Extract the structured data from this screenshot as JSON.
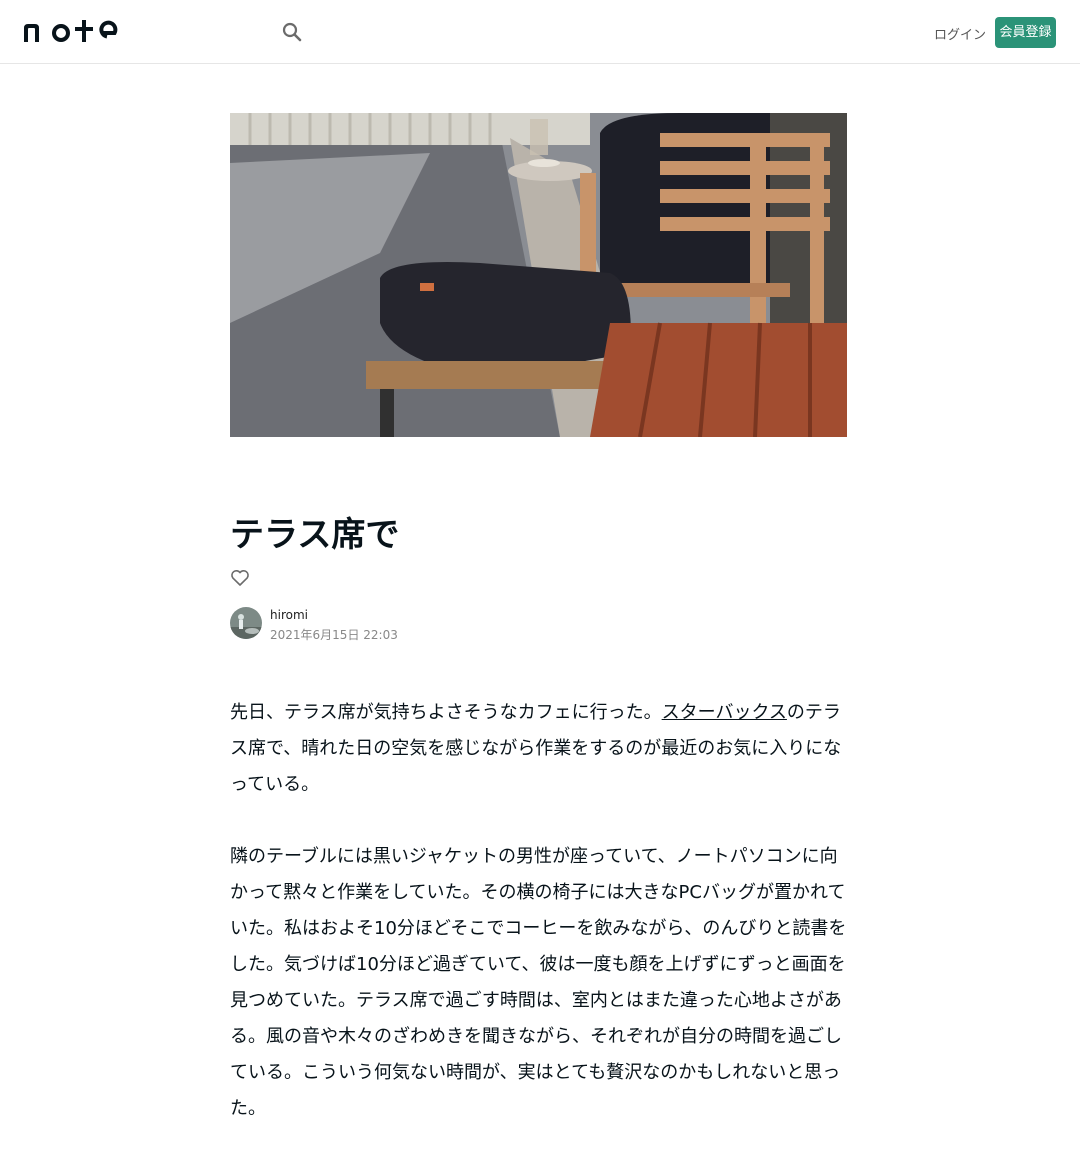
{
  "header": {
    "logo_text": "note",
    "login_label": "ログイン",
    "signup_label": "会員登録",
    "accent_color": "#2b9378"
  },
  "article": {
    "title": "テラス席で",
    "author": "hiromi",
    "date": "2021年6月15日 22:03",
    "paragraph1_before": "先日、テラス席が気持ちよさそうなカフェに行った。",
    "paragraph1_link": "スターバックス",
    "paragraph1_after": "のテラス席で、晴れた日の空気を感じながら作業をするのが最近のお気に入りになっている。",
    "paragraph2": "隣のテーブルには黒いジャケットの男性が座っていて、ノートパソコンに向かって黙々と作業をしていた。その横の椅子には大きなPCバッグが置かれていた。私はおよそ10分ほどそこでコーヒーを飲みながら、のんびりと読書をした。気づけば10分ほど過ぎていて、彼は一度も顔を上げずにずっと画面を見つめていた。テラス席で過ごす時間は、室内とはまた違った心地よさがある。風の音や木々のざわめきを聞きながら、それぞれが自分の時間を過ごしている。こういう何気ない時間が、実はとても贅沢なのかもしれないと思った。"
  },
  "icons": {
    "search": "search-icon",
    "like": "heart-icon",
    "avatar": "avatar-image"
  }
}
